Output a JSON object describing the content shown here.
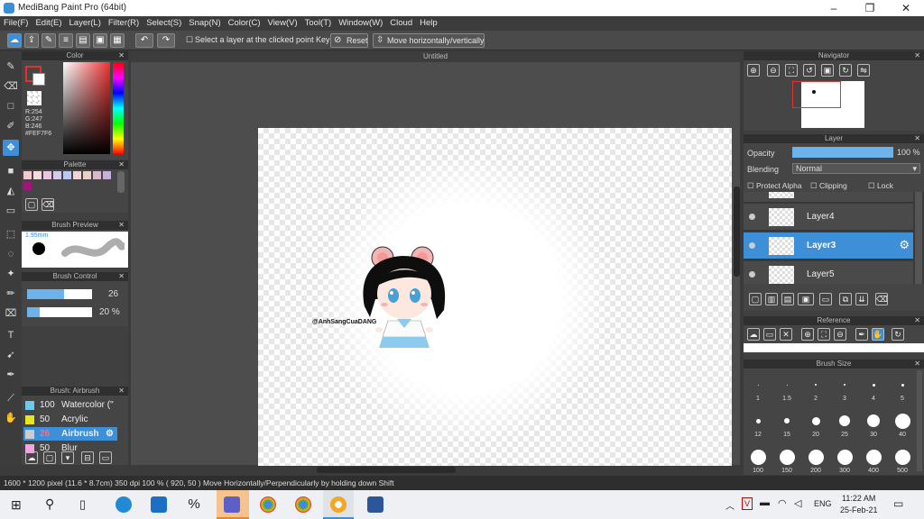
{
  "window": {
    "title": "MediBang Paint Pro (64bit)",
    "minimize": "–",
    "restore": "❐",
    "close": "✕"
  },
  "menu": [
    "File(F)",
    "Edit(E)",
    "Layer(L)",
    "Filter(R)",
    "Select(S)",
    "Snap(N)",
    "Color(C)",
    "View(V)",
    "Tool(T)",
    "Window(W)",
    "Cloud",
    "Help"
  ],
  "toolbar": {
    "select_layer_label": "Select a layer at the clicked point",
    "key_label": "Key",
    "reset_label": "Reset",
    "move_label": "Move horizontally/vertically",
    "checkbox": "☐"
  },
  "color_panel": {
    "title": "Color",
    "r": "R:254",
    "g": "G:247",
    "b": "B:246",
    "hex": "#FEF7F6",
    "primary": "#fef7f6"
  },
  "palette_panel": {
    "title": "Palette",
    "swatches": [
      "#f7c8d0",
      "#f9d9d9",
      "#e8c6e0",
      "#d6c8ee",
      "#bcc8f0",
      "#f0d4d8",
      "#e8d0c6",
      "#d9b8c8",
      "#c4b0d8",
      "#a0167a"
    ]
  },
  "brush_preview": {
    "title": "Brush Preview",
    "size": "1.95mm"
  },
  "brush_control": {
    "title": "Brush Control",
    "size_value": "26",
    "opacity_value": "20 %",
    "size_fraction": 0.26,
    "opacity_fraction": 0.2
  },
  "brush_list": {
    "title": "Brush: Airbrush",
    "items": [
      {
        "size": "100",
        "name": "Watercolor (\"",
        "color": "#6ec9f0"
      },
      {
        "size": "50",
        "name": "Acrylic",
        "color": "#e6e61e"
      },
      {
        "size": "26",
        "name": "Airbrush",
        "color": "#cccccc"
      },
      {
        "size": "50",
        "name": "Blur",
        "color": "#f2a6e6"
      }
    ]
  },
  "canvas": {
    "tab_title": "Untitled",
    "signature": "@AnhSangCuaDANG"
  },
  "navigator": {
    "title": "Navigator"
  },
  "layer_panel": {
    "title": "Layer",
    "opacity_label": "Opacity",
    "opacity_value": "100 %",
    "opacity_fraction": 1.0,
    "blending_label": "Blending",
    "blending_value": "Normal",
    "protect_alpha": "Protect Alpha",
    "clipping": "Clipping",
    "lock": "Lock",
    "layers": [
      "Layer4",
      "Layer3",
      "Layer5"
    ],
    "selected": "Layer3"
  },
  "reference": {
    "title": "Reference"
  },
  "brush_size": {
    "title": "Brush Size",
    "row1": [
      "·",
      "·",
      "·",
      "·",
      "·",
      "·"
    ],
    "row1_labels": [
      "1",
      "1.5",
      "2",
      "3",
      "4",
      "5"
    ],
    "row2_labels": [
      "12",
      "15",
      "20",
      "25",
      "30",
      "40"
    ],
    "row3_labels": [
      "100",
      "150",
      "200",
      "300",
      "400",
      "500"
    ]
  },
  "status": {
    "text": "1600 * 1200 pixel   (11.6 * 8.7cm)   350 dpi   100 %   ( 920, 50 )   Move Horizontally/Perpendicularly by holding down Shift"
  },
  "taskbar": {
    "time": "11:22 AM",
    "date": "25-Feb-21",
    "lang": "ENG",
    "accent": "#3d8fd8"
  }
}
